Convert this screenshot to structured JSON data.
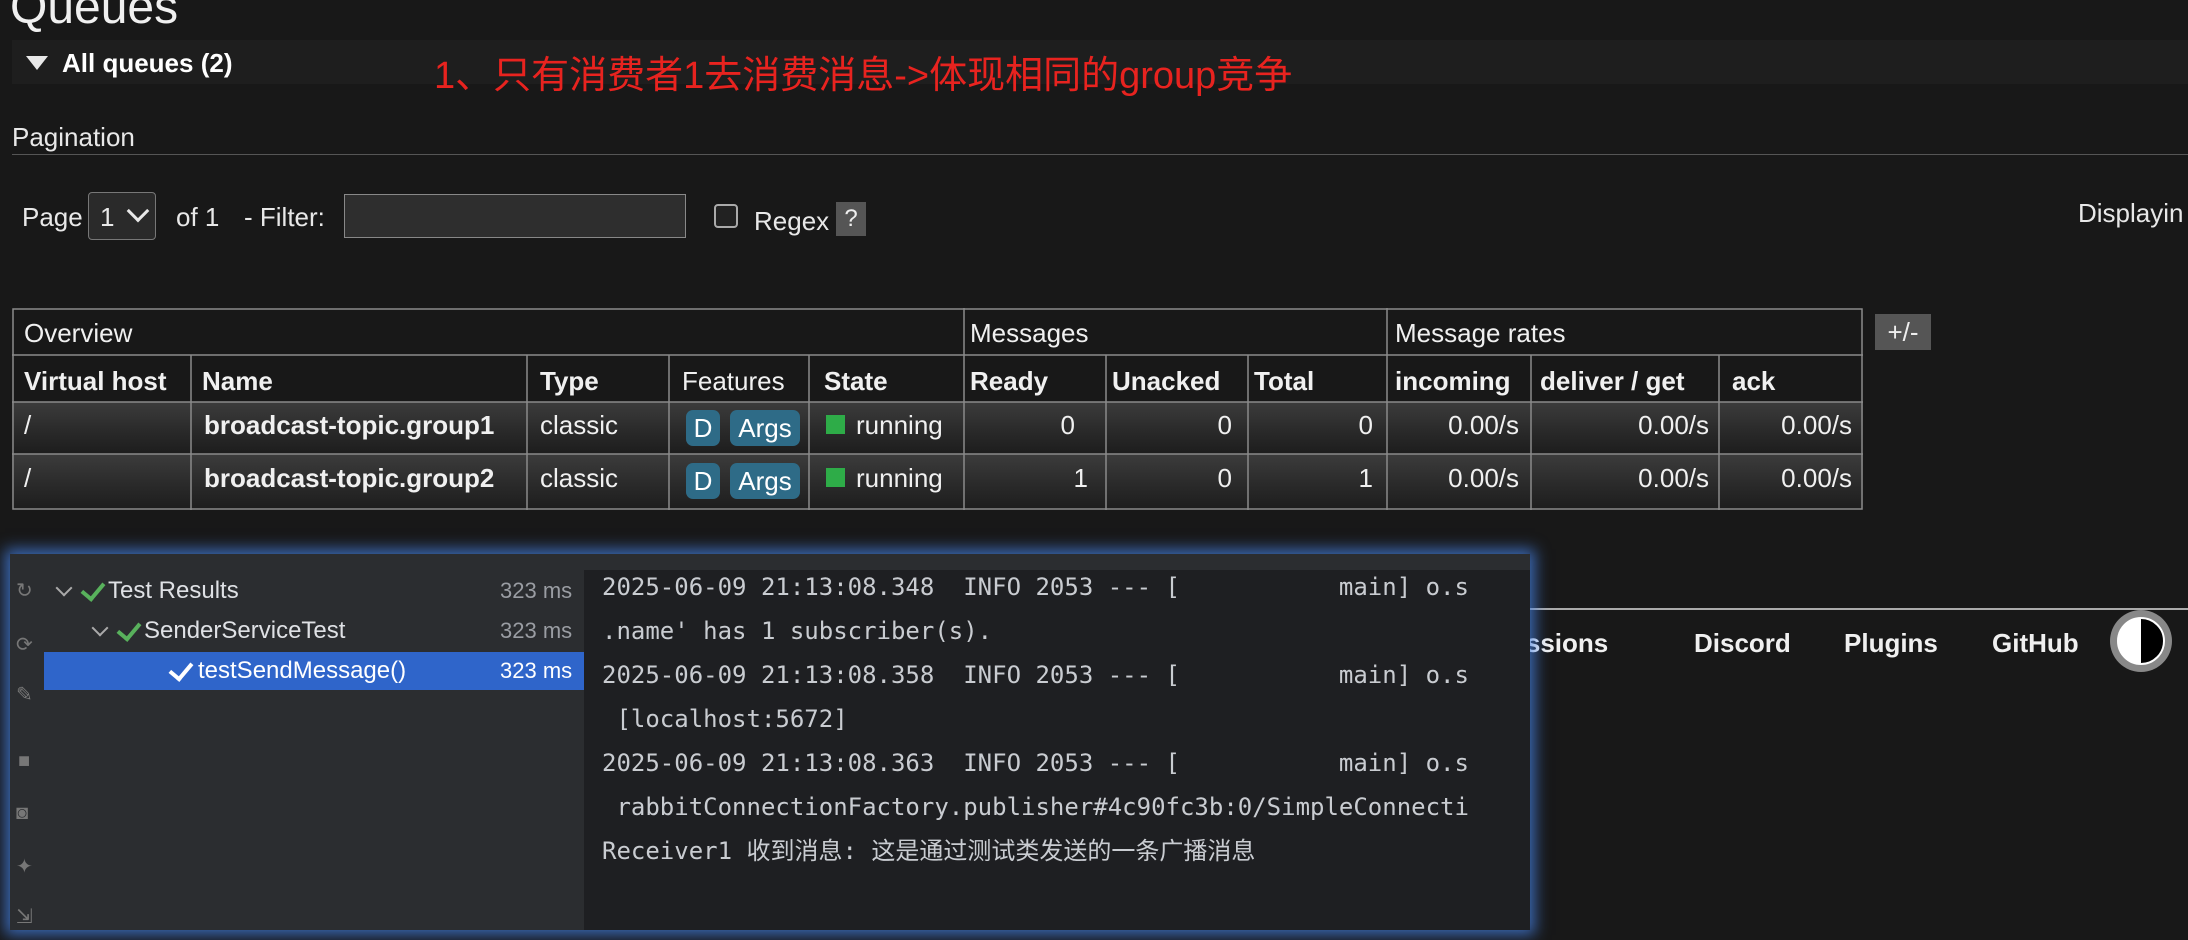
{
  "page": {
    "title": "Queues"
  },
  "section": {
    "title": "All queues (2)"
  },
  "annotation": "1、只有消费者1去消费消息->体现相同的group竞争",
  "pagination": {
    "label": "Pagination",
    "page_label": "Page",
    "page_value": "1",
    "of_label": "of 1",
    "filter_label": "- Filter:",
    "filter_value": "",
    "regex_label": "Regex",
    "help_label": "?",
    "displaying_label": "Displayin"
  },
  "table": {
    "groups": [
      "Overview",
      "Messages",
      "Message rates"
    ],
    "columns": [
      "Virtual host",
      "Name",
      "Type",
      "Features",
      "State",
      "Ready",
      "Unacked",
      "Total",
      "incoming",
      "deliver / get",
      "ack"
    ],
    "rows": [
      {
        "vhost": "/",
        "name": "broadcast-topic.group1",
        "type": "classic",
        "feature_d": "D",
        "feature_args": "Args",
        "state": "running",
        "ready": "0",
        "unacked": "0",
        "total": "0",
        "incoming": "0.00/s",
        "deliver": "0.00/s",
        "ack": "0.00/s"
      },
      {
        "vhost": "/",
        "name": "broadcast-topic.group2",
        "type": "classic",
        "feature_d": "D",
        "feature_args": "Args",
        "state": "running",
        "ready": "1",
        "unacked": "0",
        "total": "1",
        "incoming": "0.00/s",
        "deliver": "0.00/s",
        "ack": "0.00/s"
      }
    ],
    "toggle_columns_label": "+/-",
    "state_color": "#2eac48",
    "badge_color": "#2e6b87"
  },
  "test_results": {
    "items": [
      {
        "label": "Test Results",
        "time": "323 ms"
      },
      {
        "label": "SenderServiceTest",
        "time": "323 ms"
      },
      {
        "label": "testSendMessage()",
        "time": "323 ms"
      }
    ],
    "selected_color": "#2f65ca",
    "pass_color": "#58b15c"
  },
  "console": {
    "lines": [
      "2025-06-09 21:13:08.348  INFO 2053 --- [           main] o.s",
      ".name' has 1 subscriber(s).",
      "2025-06-09 21:13:08.358  INFO 2053 --- [           main] o.s",
      " [localhost:5672]",
      "2025-06-09 21:13:08.363  INFO 2053 --- [           main] o.s",
      " rabbitConnectionFactory.publisher#4c90fc3b:0/SimpleConnecti",
      "Receiver1 收到消息: 这是通过测试类发送的一条广播消息"
    ]
  },
  "footer": {
    "links": [
      "ussions",
      "Discord",
      "Plugins",
      "GitHub"
    ]
  },
  "colors": {
    "background": "#181818",
    "annotation": "#e8231f",
    "focus_glow": "#4682e6"
  }
}
